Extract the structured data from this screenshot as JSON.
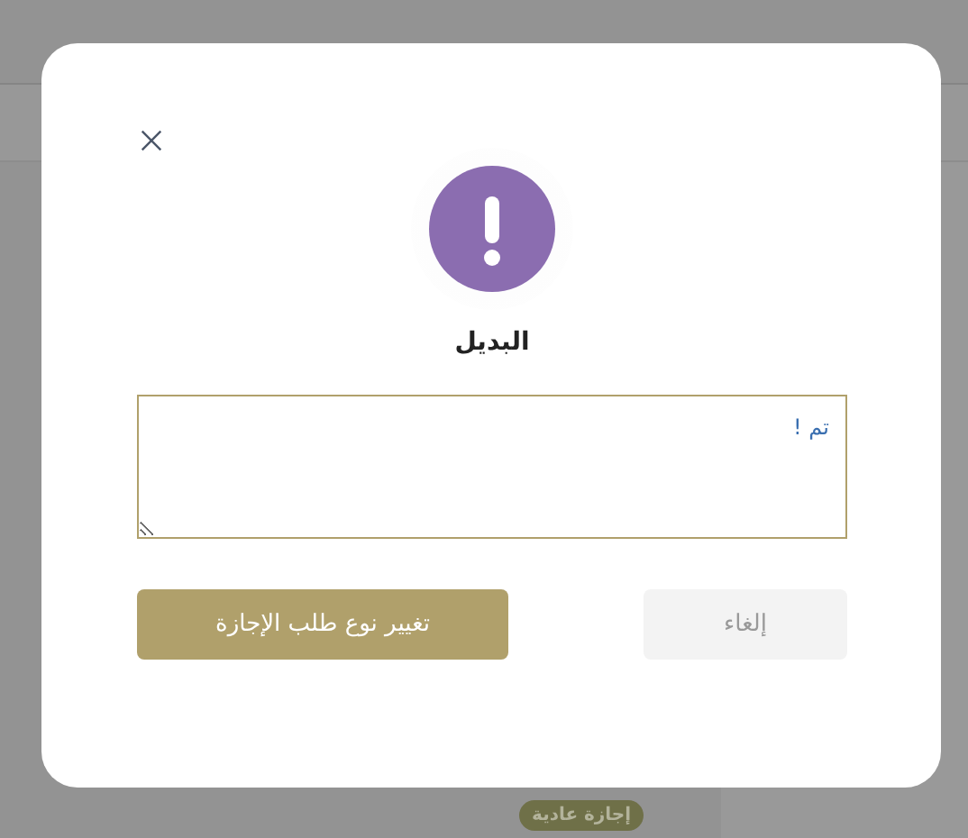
{
  "background": {
    "badge": "إجازة عادية"
  },
  "dialog": {
    "title": "البديل",
    "field": {
      "value": "تم !"
    },
    "buttons": [
      {
        "label": "إلغاء",
        "kind": "secondary"
      },
      {
        "label": "تغيير نوع طلب الإجازة",
        "kind": "primary"
      }
    ]
  }
}
